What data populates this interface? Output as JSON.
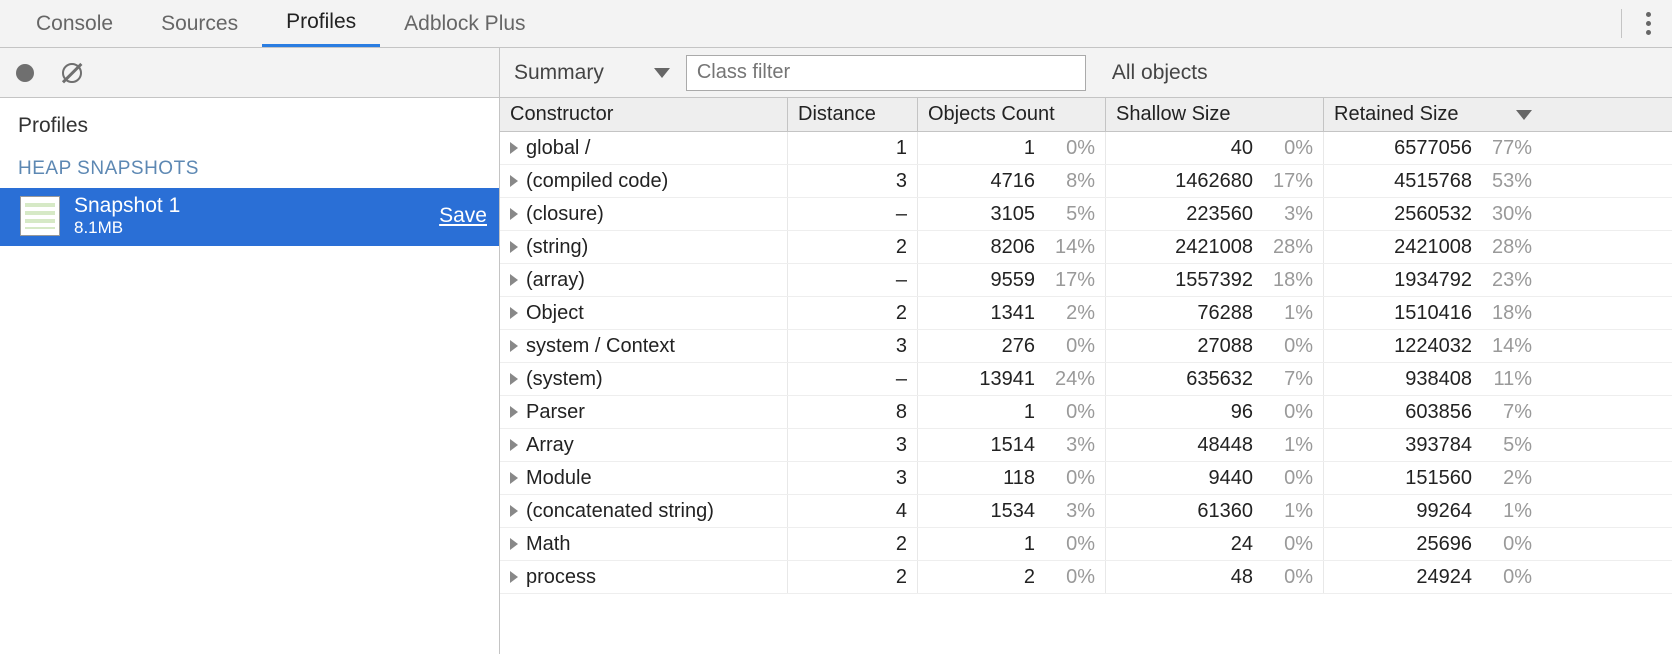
{
  "tabs": [
    "Console",
    "Sources",
    "Profiles",
    "Adblock Plus"
  ],
  "active_tab_index": 2,
  "sidebar": {
    "section_title": "Profiles",
    "sub_heading": "HEAP SNAPSHOTS",
    "snapshot": {
      "title": "Snapshot 1",
      "size": "8.1MB",
      "save_label": "Save"
    }
  },
  "toolbar": {
    "view": "Summary",
    "filter_placeholder": "Class filter",
    "scope": "All objects"
  },
  "columns": [
    "Constructor",
    "Distance",
    "Objects Count",
    "Shallow Size",
    "Retained Size"
  ],
  "rows": [
    {
      "constructor": "global /",
      "distance": "1",
      "count": "1",
      "count_pct": "0%",
      "shallow": "40",
      "shallow_pct": "0%",
      "retained": "6577056",
      "retained_pct": "77%"
    },
    {
      "constructor": "(compiled code)",
      "distance": "3",
      "count": "4716",
      "count_pct": "8%",
      "shallow": "1462680",
      "shallow_pct": "17%",
      "retained": "4515768",
      "retained_pct": "53%"
    },
    {
      "constructor": "(closure)",
      "distance": "–",
      "count": "3105",
      "count_pct": "5%",
      "shallow": "223560",
      "shallow_pct": "3%",
      "retained": "2560532",
      "retained_pct": "30%"
    },
    {
      "constructor": "(string)",
      "distance": "2",
      "count": "8206",
      "count_pct": "14%",
      "shallow": "2421008",
      "shallow_pct": "28%",
      "retained": "2421008",
      "retained_pct": "28%"
    },
    {
      "constructor": "(array)",
      "distance": "–",
      "count": "9559",
      "count_pct": "17%",
      "shallow": "1557392",
      "shallow_pct": "18%",
      "retained": "1934792",
      "retained_pct": "23%"
    },
    {
      "constructor": "Object",
      "distance": "2",
      "count": "1341",
      "count_pct": "2%",
      "shallow": "76288",
      "shallow_pct": "1%",
      "retained": "1510416",
      "retained_pct": "18%"
    },
    {
      "constructor": "system / Context",
      "distance": "3",
      "count": "276",
      "count_pct": "0%",
      "shallow": "27088",
      "shallow_pct": "0%",
      "retained": "1224032",
      "retained_pct": "14%"
    },
    {
      "constructor": "(system)",
      "distance": "–",
      "count": "13941",
      "count_pct": "24%",
      "shallow": "635632",
      "shallow_pct": "7%",
      "retained": "938408",
      "retained_pct": "11%"
    },
    {
      "constructor": "Parser",
      "distance": "8",
      "count": "1",
      "count_pct": "0%",
      "shallow": "96",
      "shallow_pct": "0%",
      "retained": "603856",
      "retained_pct": "7%"
    },
    {
      "constructor": "Array",
      "distance": "3",
      "count": "1514",
      "count_pct": "3%",
      "shallow": "48448",
      "shallow_pct": "1%",
      "retained": "393784",
      "retained_pct": "5%"
    },
    {
      "constructor": "Module",
      "distance": "3",
      "count": "118",
      "count_pct": "0%",
      "shallow": "9440",
      "shallow_pct": "0%",
      "retained": "151560",
      "retained_pct": "2%"
    },
    {
      "constructor": "(concatenated string)",
      "distance": "4",
      "count": "1534",
      "count_pct": "3%",
      "shallow": "61360",
      "shallow_pct": "1%",
      "retained": "99264",
      "retained_pct": "1%"
    },
    {
      "constructor": "Math",
      "distance": "2",
      "count": "1",
      "count_pct": "0%",
      "shallow": "24",
      "shallow_pct": "0%",
      "retained": "25696",
      "retained_pct": "0%"
    },
    {
      "constructor": "process",
      "distance": "2",
      "count": "2",
      "count_pct": "0%",
      "shallow": "48",
      "shallow_pct": "0%",
      "retained": "24924",
      "retained_pct": "0%"
    }
  ]
}
